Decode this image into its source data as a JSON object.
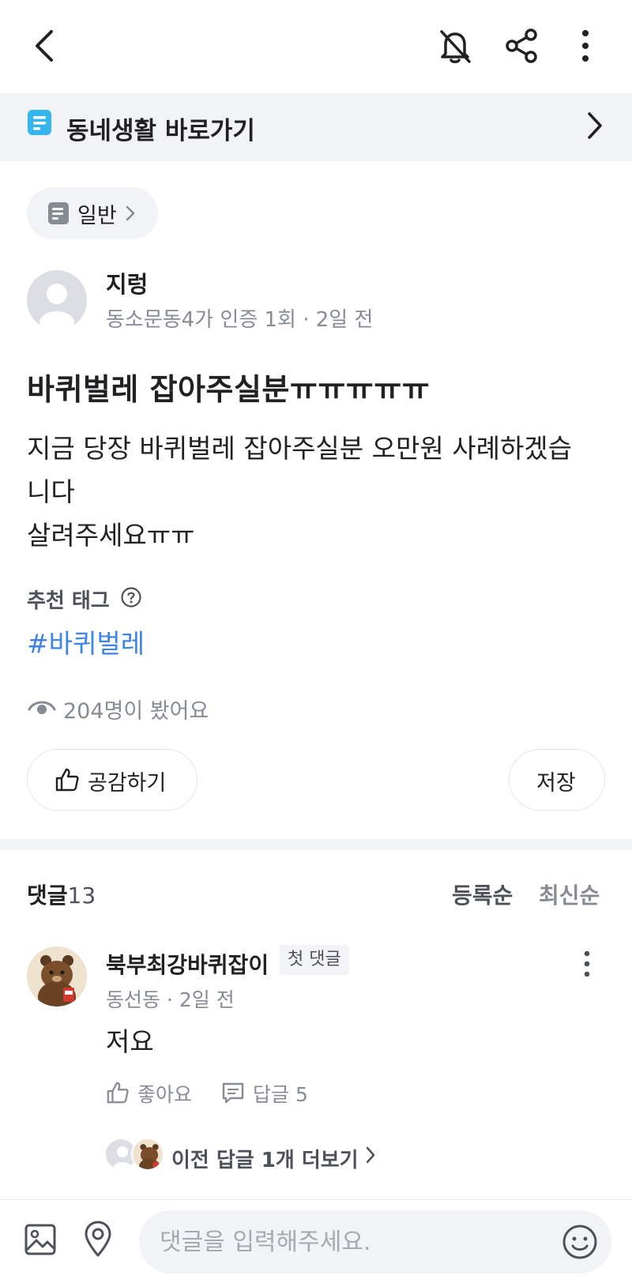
{
  "shortcut": {
    "label": "동네생활 바로가기"
  },
  "category": {
    "label": "일반"
  },
  "author": {
    "name": "지렁",
    "meta": "동소문동4가 인증 1회 · 2일 전"
  },
  "post": {
    "title": "바퀴벌레 잡아주실분ㅠㅠㅠㅠㅠ",
    "body_lines": [
      "지금 당장 바퀴벌레 잡아주실분 오만원 사례하겠습",
      "니다",
      "살려주세요ㅠㅠ"
    ]
  },
  "tags": {
    "label": "추천 태그",
    "items": [
      "#바퀴벌레"
    ]
  },
  "views": {
    "text": "204명이 봤어요"
  },
  "actions": {
    "like_label": "공감하기",
    "save_label": "저장"
  },
  "comments": {
    "label": "댓글",
    "count": "13",
    "sort": [
      "등록순",
      "최신순"
    ],
    "items": [
      {
        "author": "북부최강바퀴잡이",
        "badge": "첫 댓글",
        "meta": "동선동 · 2일 전",
        "text": "저요",
        "like_label": "좋아요",
        "reply_label": "답글 5"
      }
    ],
    "more_replies": "이전 답글 1개 더보기"
  },
  "composer": {
    "placeholder": "댓글을 입력해주세요."
  },
  "colors": {
    "accent_link": "#3d84e6",
    "muted": "#868b94",
    "surface": "#f2f3f6",
    "shortcut_icon": "#35b5ee"
  },
  "icons": [
    "back-arrow-icon",
    "bell-off-icon",
    "share-icon",
    "more-vertical-icon",
    "board-icon",
    "chevron-right-icon",
    "question-circle-icon",
    "eye-icon",
    "thumbs-up-icon",
    "reply-icon",
    "image-icon",
    "location-icon",
    "smiley-icon"
  ]
}
